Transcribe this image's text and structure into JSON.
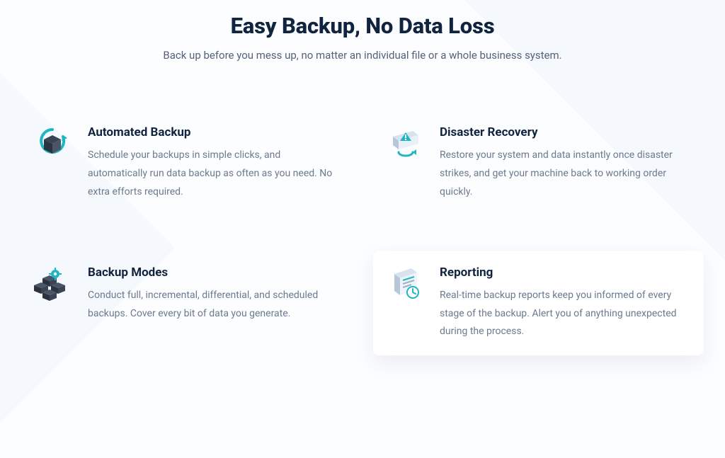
{
  "header": {
    "title": "Easy Backup, No Data Loss",
    "subtitle": "Back up before you mess up, no matter an individual file or a whole business system."
  },
  "features": [
    {
      "icon": "refresh-cube-icon",
      "title": "Automated Backup",
      "description": "Schedule your backups in simple clicks, and automatically run data backup as often as you need. No extra efforts required."
    },
    {
      "icon": "monitor-alert-icon",
      "title": "Disaster Recovery",
      "description": "Restore your system and data instantly once disaster strikes, and get your machine back to working order quickly."
    },
    {
      "icon": "blocks-gear-icon",
      "title": "Backup Modes",
      "description": "Conduct full, incremental, differential, and scheduled backups. Cover every bit of data you generate."
    },
    {
      "icon": "clipboard-clock-icon",
      "title": "Reporting",
      "description": "Real-time backup reports keep you informed of every stage of the backup. Alert you of anything unexpected during the process."
    }
  ]
}
